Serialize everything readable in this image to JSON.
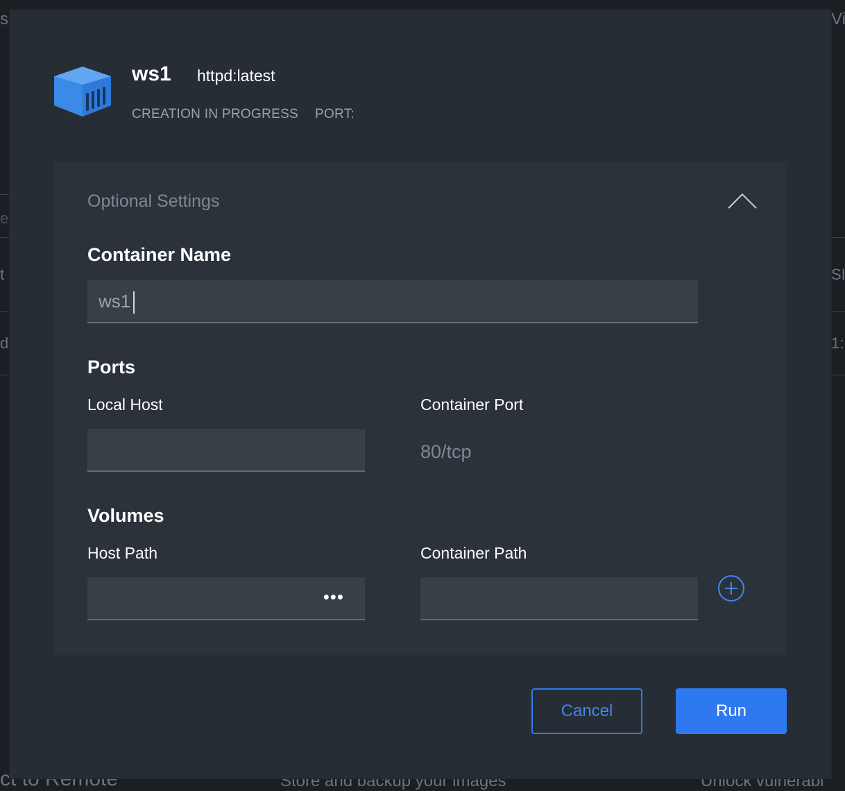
{
  "background": {
    "fragments": [
      "s",
      "ea",
      "t",
      "d",
      "Vi",
      "SI",
      "1:",
      "ct to Remote",
      "Store and backup your images",
      "Unlock vulnerabi"
    ]
  },
  "modal": {
    "container_name": "ws1",
    "image": "httpd:latest",
    "status": "CREATION IN PROGRESS",
    "port_label": "PORT:",
    "logo_icon": "container-icon",
    "accent_color": "#2f79f0"
  },
  "optional_settings": {
    "title": "Optional Settings",
    "toggle_icon": "chevron-up-icon",
    "container_name_heading": "Container Name",
    "container_name_value": "ws1",
    "ports": {
      "heading": "Ports",
      "local_host_label": "Local Host",
      "local_host_value": "",
      "container_port_label": "Container Port",
      "container_port_value": "80/tcp"
    },
    "volumes": {
      "heading": "Volumes",
      "host_path_label": "Host Path",
      "host_path_value": "",
      "browse_icon": "ellipsis-icon",
      "browse_glyph": "•••",
      "container_path_label": "Container Path",
      "container_path_value": "",
      "add_icon": "plus-circle-icon"
    }
  },
  "actions": {
    "cancel_label": "Cancel",
    "run_label": "Run"
  }
}
